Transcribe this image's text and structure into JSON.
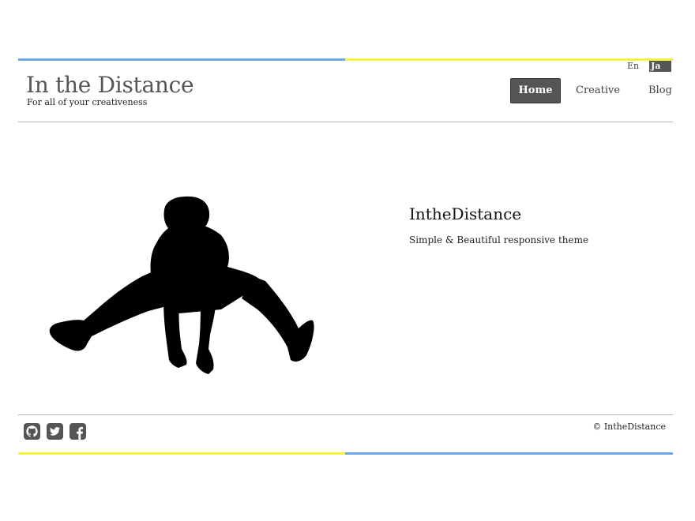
{
  "colors": {
    "accent_blue": "#6fa8e8",
    "accent_yellow": "#f2f53a",
    "nav_active_bg": "#555555",
    "rule": "#b3b3b3",
    "icon": "#555555"
  },
  "language": {
    "en_label": "En",
    "ja_label": "Ja",
    "active": "Ja"
  },
  "header": {
    "title": "In the Distance",
    "tagline": "For all of your creativeness"
  },
  "nav": {
    "items": [
      {
        "label": "Home",
        "active": true
      },
      {
        "label": "Creative",
        "active": false
      },
      {
        "label": "Blog",
        "active": false
      }
    ]
  },
  "hero": {
    "image_icon": "jumping-person-silhouette",
    "title": "IntheDistance",
    "subtitle": "Simple & Beautiful responsive theme"
  },
  "footer": {
    "social": [
      {
        "icon": "github-icon"
      },
      {
        "icon": "twitter-icon"
      },
      {
        "icon": "facebook-icon"
      }
    ],
    "copyright": "© IntheDistance"
  }
}
